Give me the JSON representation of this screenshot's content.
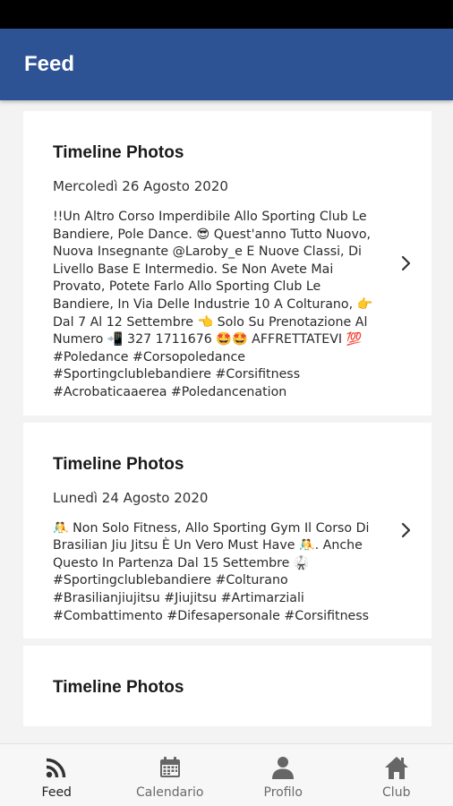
{
  "app_bar": {
    "title": "Feed"
  },
  "feed": {
    "cards": [
      {
        "title": "Timeline Photos",
        "date": "Mercoledì 26 Agosto 2020",
        "text": "!!Un Altro Corso Imperdibile Allo Sporting Club Le Bandiere, Pole Dance. 😎 Quest'anno Tutto Nuovo, Nuova Insegnante @Laroby_e E Nuove Classi, Di Livello Base E Intermedio. Se Non Avete Mai Provato, Potete Farlo Allo Sporting Club Le Bandiere, In Via Delle Industrie 10 A Colturano, 👉 Dal 7 Al 12 Settembre 👈 Solo Su Prenotazione Al Numero 📲 327 1711676 🤩🤩 AFFRETTATEVI 💯 #Poledance #Corsopoledance #Sportingclublebandiere #Corsifitness #Acrobaticaaerea #Poledancenation"
      },
      {
        "title": "Timeline Photos",
        "date": "Lunedì 24 Agosto 2020",
        "text": "🤼 Non Solo Fitness, Allo Sporting Gym Il Corso Di Brasilian Jiu Jitsu È Un Vero Must Have 🤼. Anche Questo In Partenza Dal 15 Settembre 🥋 #Sportingclublebandiere #Colturano #Brasilianjiujitsu #Jiujitsu #Artimarziali #Combattimento #Difesapersonale #Corsifitness"
      },
      {
        "title": "Timeline Photos",
        "date": "",
        "text": ""
      }
    ]
  },
  "bottom_nav": {
    "items": [
      {
        "label": "Feed",
        "icon": "rss-icon",
        "active": true
      },
      {
        "label": "Calendario",
        "icon": "calendar-icon",
        "active": false
      },
      {
        "label": "Profilo",
        "icon": "person-icon",
        "active": false
      },
      {
        "label": "Club",
        "icon": "home-icon",
        "active": false
      }
    ]
  },
  "colors": {
    "app_bar": "#2d5395",
    "status_bar": "#000000",
    "background": "#f3f3f3",
    "card": "#ffffff",
    "nav_icon": "#444444"
  }
}
